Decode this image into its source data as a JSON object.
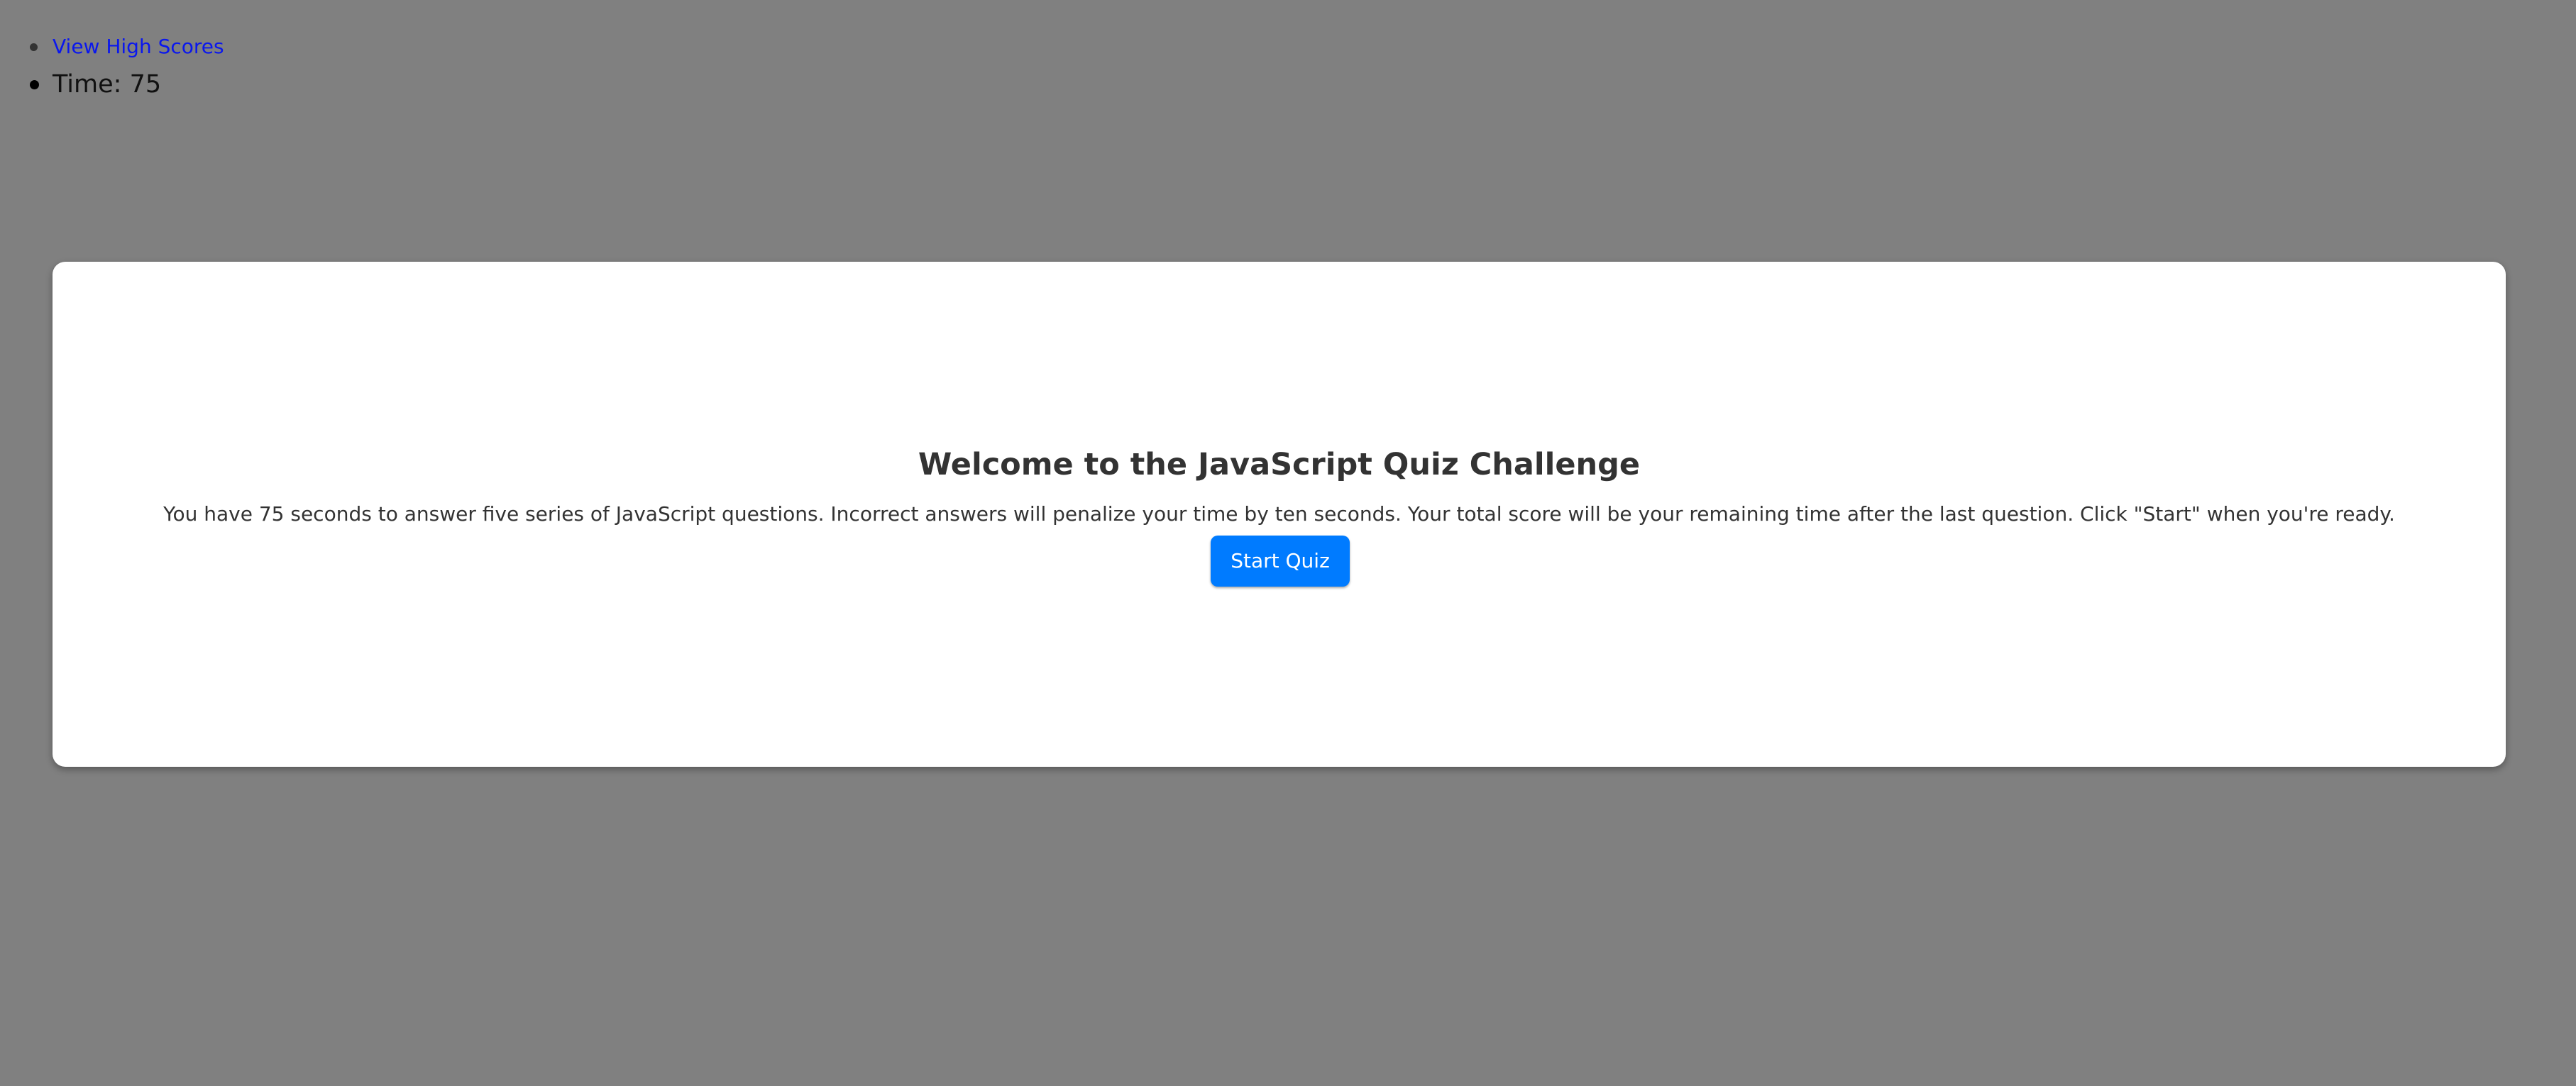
{
  "nav": {
    "high_scores_label": "View High Scores",
    "timer_text": "Time: 75"
  },
  "quiz": {
    "title": "Welcome to the JavaScript Quiz Challenge",
    "description": "You have 75 seconds to answer five series of JavaScript questions. Incorrect answers will penalize your time by ten seconds. Your total score will be your remaining time after the last question. Click \"Start\" when you're ready.",
    "start_button_label": "Start Quiz"
  },
  "colors": {
    "page_background": "#808080",
    "card_background": "#ffffff",
    "link": "#0a17ee",
    "button_primary": "#007bff",
    "text_dark": "#333333"
  }
}
